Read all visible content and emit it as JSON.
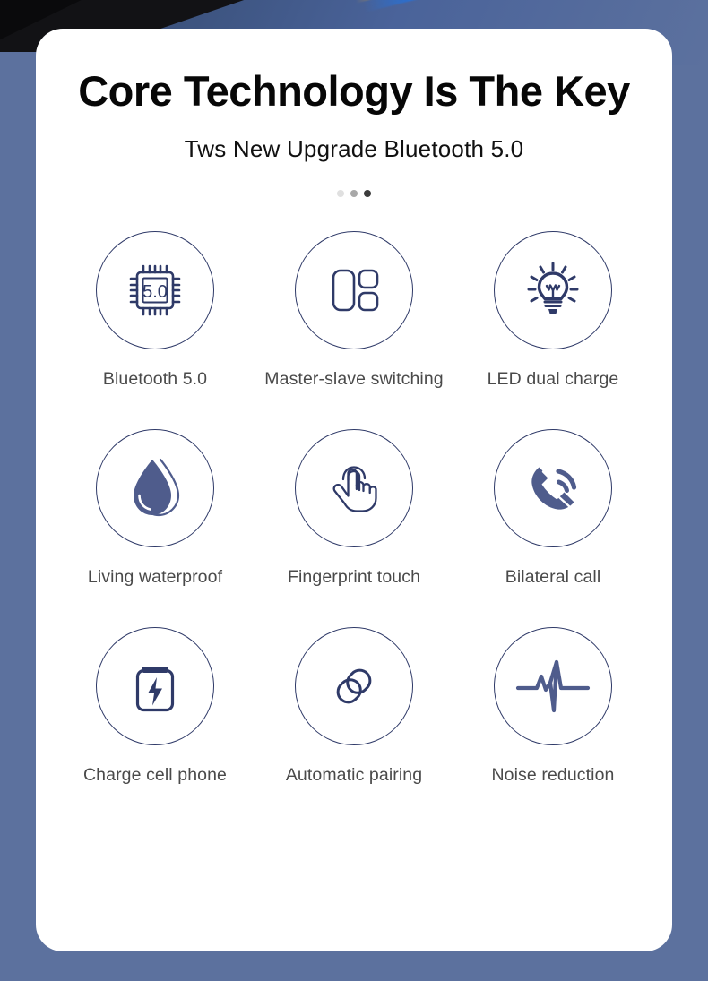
{
  "card": {
    "headline": "Core Technology Is The Key",
    "subheadline": "Tws New Upgrade Bluetooth 5.0"
  },
  "pagination": {
    "dots": [
      {
        "name": "dot-1",
        "color": "#e0e0e0",
        "active": false
      },
      {
        "name": "dot-2",
        "color": "#a8a8a8",
        "active": false
      },
      {
        "name": "dot-3",
        "color": "#3c3c3c",
        "active": true
      }
    ]
  },
  "theme": {
    "background": "#5c719e",
    "card_background": "#ffffff",
    "icon_stroke": "#2f3a68",
    "icon_fill": "#4f5c8c",
    "label_color": "#4a4a4a",
    "headline_color": "#070707"
  },
  "features": [
    {
      "icon": "chip-5-icon",
      "chip_text": "5.0",
      "label": "Bluetooth 5.0"
    },
    {
      "icon": "master-slave-layout-icon",
      "label": "Master-slave switching"
    },
    {
      "icon": "light-bulb-icon",
      "label": "LED dual charge"
    },
    {
      "icon": "water-drop-icon",
      "label": "Living waterproof"
    },
    {
      "icon": "tap-hand-icon",
      "label": "Fingerprint touch"
    },
    {
      "icon": "phone-call-icon",
      "label": "Bilateral call"
    },
    {
      "icon": "battery-charge-icon",
      "label": "Charge cell phone"
    },
    {
      "icon": "chain-link-icon",
      "label": "Automatic pairing"
    },
    {
      "icon": "waveform-pulse-icon",
      "label": "Noise reduction"
    }
  ]
}
